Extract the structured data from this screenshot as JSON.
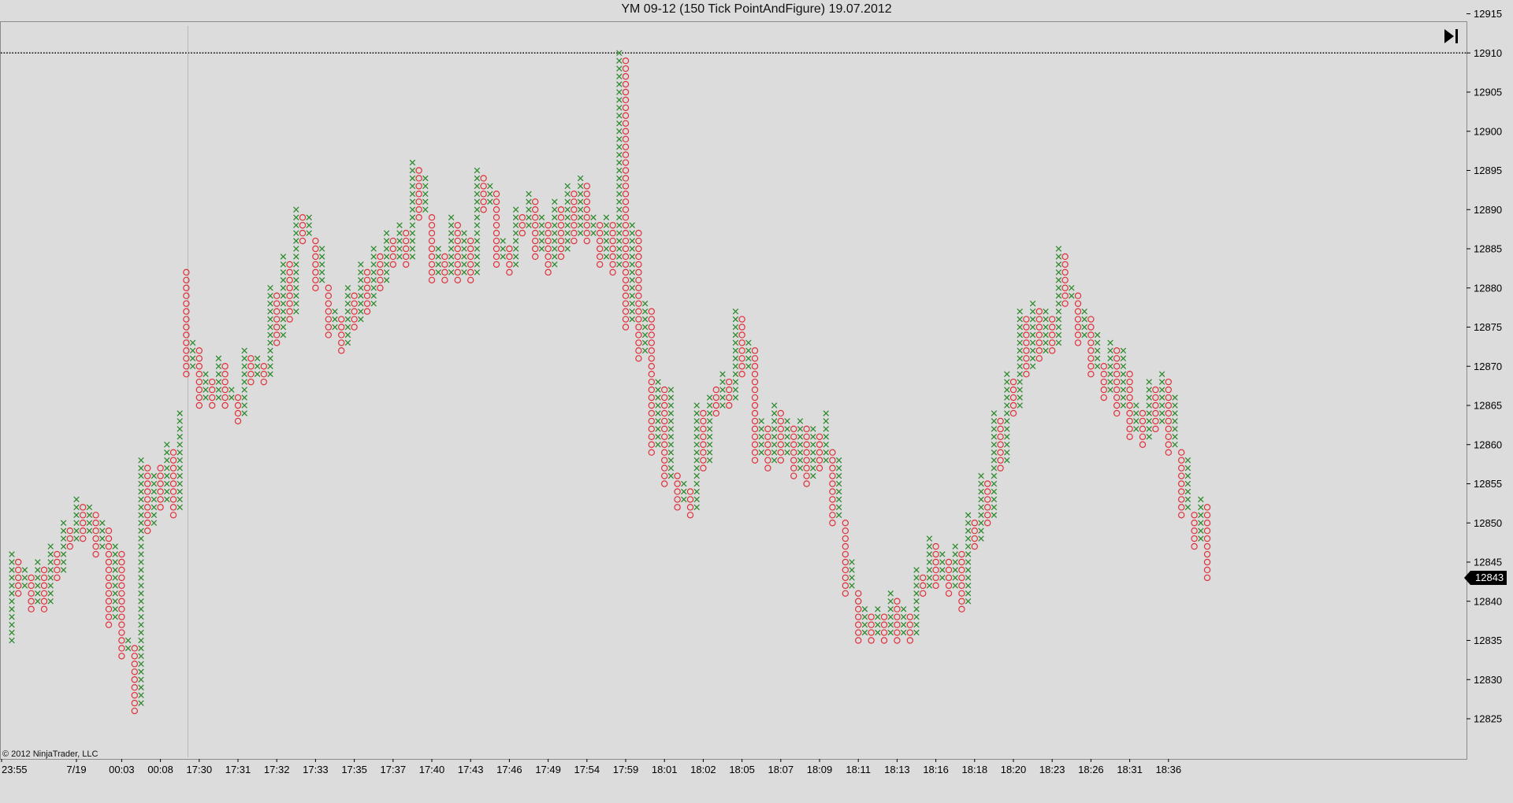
{
  "window": {
    "title": "YM 09-12 (150 Tick PointAndFigure)  19.07.2012"
  },
  "copyright": "© 2012 NinjaTrader, LLC",
  "last_price": "12843",
  "colors": {
    "up": "#2e8b2e",
    "down": "#e0303a",
    "background": "#dcdcdc",
    "grid": "#000000"
  },
  "icons": {
    "goto_end": "skip-to-end-icon"
  },
  "chart_data": {
    "type": "point-and-figure",
    "title": "YM 09-12 (150 Tick PointAndFigure)  19.07.2012",
    "box_size": 1,
    "y_range": [
      12823,
      12916
    ],
    "y_ticks": [
      12825,
      12830,
      12835,
      12840,
      12845,
      12850,
      12855,
      12860,
      12865,
      12870,
      12875,
      12880,
      12885,
      12890,
      12895,
      12900,
      12905,
      12910,
      12915
    ],
    "reference_line": 12910,
    "session_break_after_column": 27,
    "last_price": 12843,
    "x_tick_labels": [
      {
        "column": 0,
        "label": "23:55"
      },
      {
        "column": 10,
        "label": "7/19"
      },
      {
        "column": 17,
        "label": "00:03"
      },
      {
        "column": 23,
        "label": "00:08"
      },
      {
        "column": 29,
        "label": "17:30"
      },
      {
        "column": 35,
        "label": "17:31"
      },
      {
        "column": 41,
        "label": "17:32"
      },
      {
        "column": 47,
        "label": "17:33"
      },
      {
        "column": 53,
        "label": "17:35"
      },
      {
        "column": 59,
        "label": "17:37"
      },
      {
        "column": 65,
        "label": "17:40"
      },
      {
        "column": 71,
        "label": "17:43"
      },
      {
        "column": 77,
        "label": "17:46"
      },
      {
        "column": 83,
        "label": "17:49"
      },
      {
        "column": 89,
        "label": "17:54"
      },
      {
        "column": 95,
        "label": "17:59"
      },
      {
        "column": 101,
        "label": "18:01"
      },
      {
        "column": 107,
        "label": "18:02"
      },
      {
        "column": 113,
        "label": "18:05"
      },
      {
        "column": 119,
        "label": "18:07"
      },
      {
        "column": 125,
        "label": "18:09"
      },
      {
        "column": 131,
        "label": "18:11"
      },
      {
        "column": 137,
        "label": "18:13"
      },
      {
        "column": 143,
        "label": "18:16"
      },
      {
        "column": 149,
        "label": "18:18"
      },
      {
        "column": 155,
        "label": "18:20"
      },
      {
        "column": 161,
        "label": "18:23"
      },
      {
        "column": 167,
        "label": "18:26"
      },
      {
        "column": 173,
        "label": "18:31"
      },
      {
        "column": 179,
        "label": "18:36"
      }
    ],
    "columns": [
      {
        "t": "X",
        "lo": 12835,
        "hi": 12846
      },
      {
        "t": "O",
        "lo": 12841,
        "hi": 12845
      },
      {
        "t": "X",
        "lo": 12842,
        "hi": 12844
      },
      {
        "t": "O",
        "lo": 12839,
        "hi": 12843
      },
      {
        "t": "X",
        "lo": 12840,
        "hi": 12845
      },
      {
        "t": "O",
        "lo": 12839,
        "hi": 12844
      },
      {
        "t": "X",
        "lo": 12840,
        "hi": 12847
      },
      {
        "t": "O",
        "lo": 12843,
        "hi": 12846
      },
      {
        "t": "X",
        "lo": 12844,
        "hi": 12850
      },
      {
        "t": "O",
        "lo": 12847,
        "hi": 12849
      },
      {
        "t": "X",
        "lo": 12848,
        "hi": 12853
      },
      {
        "t": "O",
        "lo": 12848,
        "hi": 12852
      },
      {
        "t": "X",
        "lo": 12849,
        "hi": 12852
      },
      {
        "t": "O",
        "lo": 12846,
        "hi": 12851
      },
      {
        "t": "X",
        "lo": 12847,
        "hi": 12850
      },
      {
        "t": "O",
        "lo": 12837,
        "hi": 12849
      },
      {
        "t": "X",
        "lo": 12838,
        "hi": 12847
      },
      {
        "t": "O",
        "lo": 12833,
        "hi": 12846
      },
      {
        "t": "X",
        "lo": 12834,
        "hi": 12835
      },
      {
        "t": "O",
        "lo": 12826,
        "hi": 12834
      },
      {
        "t": "X",
        "lo": 12827,
        "hi": 12858
      },
      {
        "t": "O",
        "lo": 12849,
        "hi": 12857
      },
      {
        "t": "X",
        "lo": 12850,
        "hi": 12856
      },
      {
        "t": "O",
        "lo": 12852,
        "hi": 12857
      },
      {
        "t": "X",
        "lo": 12853,
        "hi": 12860
      },
      {
        "t": "O",
        "lo": 12851,
        "hi": 12859
      },
      {
        "t": "X",
        "lo": 12852,
        "hi": 12864
      },
      {
        "t": "O",
        "lo": 12869,
        "hi": 12882
      },
      {
        "t": "X",
        "lo": 12870,
        "hi": 12873
      },
      {
        "t": "O",
        "lo": 12865,
        "hi": 12872
      },
      {
        "t": "X",
        "lo": 12866,
        "hi": 12869
      },
      {
        "t": "O",
        "lo": 12865,
        "hi": 12868
      },
      {
        "t": "X",
        "lo": 12866,
        "hi": 12871
      },
      {
        "t": "O",
        "lo": 12865,
        "hi": 12870
      },
      {
        "t": "X",
        "lo": 12866,
        "hi": 12867
      },
      {
        "t": "O",
        "lo": 12863,
        "hi": 12866
      },
      {
        "t": "X",
        "lo": 12864,
        "hi": 12872
      },
      {
        "t": "O",
        "lo": 12868,
        "hi": 12871
      },
      {
        "t": "X",
        "lo": 12869,
        "hi": 12871
      },
      {
        "t": "O",
        "lo": 12868,
        "hi": 12870
      },
      {
        "t": "X",
        "lo": 12869,
        "hi": 12880
      },
      {
        "t": "O",
        "lo": 12873,
        "hi": 12879
      },
      {
        "t": "X",
        "lo": 12874,
        "hi": 12884
      },
      {
        "t": "O",
        "lo": 12876,
        "hi": 12883
      },
      {
        "t": "X",
        "lo": 12877,
        "hi": 12890
      },
      {
        "t": "O",
        "lo": 12886,
        "hi": 12889
      },
      {
        "t": "X",
        "lo": 12887,
        "hi": 12889
      },
      {
        "t": "O",
        "lo": 12880,
        "hi": 12886
      },
      {
        "t": "X",
        "lo": 12881,
        "hi": 12885
      },
      {
        "t": "O",
        "lo": 12874,
        "hi": 12880
      },
      {
        "t": "X",
        "lo": 12875,
        "hi": 12877
      },
      {
        "t": "O",
        "lo": 12872,
        "hi": 12876
      },
      {
        "t": "X",
        "lo": 12873,
        "hi": 12880
      },
      {
        "t": "O",
        "lo": 12875,
        "hi": 12879
      },
      {
        "t": "X",
        "lo": 12876,
        "hi": 12883
      },
      {
        "t": "O",
        "lo": 12877,
        "hi": 12882
      },
      {
        "t": "X",
        "lo": 12878,
        "hi": 12885
      },
      {
        "t": "O",
        "lo": 12880,
        "hi": 12884
      },
      {
        "t": "X",
        "lo": 12881,
        "hi": 12887
      },
      {
        "t": "O",
        "lo": 12883,
        "hi": 12886
      },
      {
        "t": "X",
        "lo": 12884,
        "hi": 12888
      },
      {
        "t": "O",
        "lo": 12883,
        "hi": 12887
      },
      {
        "t": "X",
        "lo": 12884,
        "hi": 12896
      },
      {
        "t": "O",
        "lo": 12889,
        "hi": 12895
      },
      {
        "t": "X",
        "lo": 12890,
        "hi": 12894
      },
      {
        "t": "O",
        "lo": 12881,
        "hi": 12889
      },
      {
        "t": "X",
        "lo": 12882,
        "hi": 12885
      },
      {
        "t": "O",
        "lo": 12881,
        "hi": 12884
      },
      {
        "t": "X",
        "lo": 12882,
        "hi": 12889
      },
      {
        "t": "O",
        "lo": 12881,
        "hi": 12888
      },
      {
        "t": "X",
        "lo": 12882,
        "hi": 12887
      },
      {
        "t": "O",
        "lo": 12881,
        "hi": 12886
      },
      {
        "t": "X",
        "lo": 12882,
        "hi": 12895
      },
      {
        "t": "O",
        "lo": 12890,
        "hi": 12894
      },
      {
        "t": "X",
        "lo": 12891,
        "hi": 12893
      },
      {
        "t": "O",
        "lo": 12883,
        "hi": 12892
      },
      {
        "t": "X",
        "lo": 12884,
        "hi": 12886
      },
      {
        "t": "O",
        "lo": 12882,
        "hi": 12885
      },
      {
        "t": "X",
        "lo": 12883,
        "hi": 12890
      },
      {
        "t": "O",
        "lo": 12887,
        "hi": 12889
      },
      {
        "t": "X",
        "lo": 12888,
        "hi": 12892
      },
      {
        "t": "O",
        "lo": 12884,
        "hi": 12891
      },
      {
        "t": "X",
        "lo": 12885,
        "hi": 12889
      },
      {
        "t": "O",
        "lo": 12882,
        "hi": 12888
      },
      {
        "t": "X",
        "lo": 12883,
        "hi": 12891
      },
      {
        "t": "O",
        "lo": 12884,
        "hi": 12890
      },
      {
        "t": "X",
        "lo": 12885,
        "hi": 12893
      },
      {
        "t": "O",
        "lo": 12886,
        "hi": 12892
      },
      {
        "t": "X",
        "lo": 12887,
        "hi": 12894
      },
      {
        "t": "O",
        "lo": 12886,
        "hi": 12893
      },
      {
        "t": "X",
        "lo": 12887,
        "hi": 12889
      },
      {
        "t": "O",
        "lo": 12883,
        "hi": 12888
      },
      {
        "t": "X",
        "lo": 12884,
        "hi": 12889
      },
      {
        "t": "O",
        "lo": 12882,
        "hi": 12888
      },
      {
        "t": "X",
        "lo": 12883,
        "hi": 12910
      },
      {
        "t": "O",
        "lo": 12875,
        "hi": 12909
      },
      {
        "t": "X",
        "lo": 12876,
        "hi": 12888
      },
      {
        "t": "O",
        "lo": 12871,
        "hi": 12887
      },
      {
        "t": "X",
        "lo": 12872,
        "hi": 12878
      },
      {
        "t": "O",
        "lo": 12859,
        "hi": 12877
      },
      {
        "t": "X",
        "lo": 12860,
        "hi": 12868
      },
      {
        "t": "O",
        "lo": 12855,
        "hi": 12867
      },
      {
        "t": "X",
        "lo": 12856,
        "hi": 12867
      },
      {
        "t": "O",
        "lo": 12852,
        "hi": 12856
      },
      {
        "t": "X",
        "lo": 12853,
        "hi": 12855
      },
      {
        "t": "O",
        "lo": 12851,
        "hi": 12854
      },
      {
        "t": "X",
        "lo": 12852,
        "hi": 12865
      },
      {
        "t": "O",
        "lo": 12857,
        "hi": 12864
      },
      {
        "t": "X",
        "lo": 12858,
        "hi": 12866
      },
      {
        "t": "O",
        "lo": 12864,
        "hi": 12867
      },
      {
        "t": "X",
        "lo": 12865,
        "hi": 12869
      },
      {
        "t": "O",
        "lo": 12865,
        "hi": 12868
      },
      {
        "t": "X",
        "lo": 12866,
        "hi": 12877
      },
      {
        "t": "O",
        "lo": 12869,
        "hi": 12876
      },
      {
        "t": "X",
        "lo": 12870,
        "hi": 12873
      },
      {
        "t": "O",
        "lo": 12858,
        "hi": 12872
      },
      {
        "t": "X",
        "lo": 12859,
        "hi": 12863
      },
      {
        "t": "O",
        "lo": 12857,
        "hi": 12862
      },
      {
        "t": "X",
        "lo": 12858,
        "hi": 12865
      },
      {
        "t": "O",
        "lo": 12858,
        "hi": 12864
      },
      {
        "t": "X",
        "lo": 12859,
        "hi": 12863
      },
      {
        "t": "O",
        "lo": 12856,
        "hi": 12862
      },
      {
        "t": "X",
        "lo": 12857,
        "hi": 12863
      },
      {
        "t": "O",
        "lo": 12855,
        "hi": 12862
      },
      {
        "t": "X",
        "lo": 12856,
        "hi": 12862
      },
      {
        "t": "O",
        "lo": 12857,
        "hi": 12861
      },
      {
        "t": "X",
        "lo": 12858,
        "hi": 12864
      },
      {
        "t": "O",
        "lo": 12850,
        "hi": 12859
      },
      {
        "t": "X",
        "lo": 12851,
        "hi": 12858
      },
      {
        "t": "O",
        "lo": 12841,
        "hi": 12850
      },
      {
        "t": "X",
        "lo": 12842,
        "hi": 12845
      },
      {
        "t": "O",
        "lo": 12835,
        "hi": 12841
      },
      {
        "t": "X",
        "lo": 12836,
        "hi": 12839
      },
      {
        "t": "O",
        "lo": 12835,
        "hi": 12838
      },
      {
        "t": "X",
        "lo": 12836,
        "hi": 12839
      },
      {
        "t": "O",
        "lo": 12835,
        "hi": 12838
      },
      {
        "t": "X",
        "lo": 12836,
        "hi": 12841
      },
      {
        "t": "O",
        "lo": 12835,
        "hi": 12840
      },
      {
        "t": "X",
        "lo": 12836,
        "hi": 12839
      },
      {
        "t": "O",
        "lo": 12835,
        "hi": 12838
      },
      {
        "t": "X",
        "lo": 12836,
        "hi": 12844
      },
      {
        "t": "O",
        "lo": 12841,
        "hi": 12843
      },
      {
        "t": "X",
        "lo": 12842,
        "hi": 12848
      },
      {
        "t": "O",
        "lo": 12842,
        "hi": 12847
      },
      {
        "t": "X",
        "lo": 12843,
        "hi": 12846
      },
      {
        "t": "O",
        "lo": 12841,
        "hi": 12845
      },
      {
        "t": "X",
        "lo": 12842,
        "hi": 12847
      },
      {
        "t": "O",
        "lo": 12839,
        "hi": 12846
      },
      {
        "t": "X",
        "lo": 12840,
        "hi": 12851
      },
      {
        "t": "O",
        "lo": 12847,
        "hi": 12850
      },
      {
        "t": "X",
        "lo": 12848,
        "hi": 12856
      },
      {
        "t": "O",
        "lo": 12850,
        "hi": 12855
      },
      {
        "t": "X",
        "lo": 12851,
        "hi": 12864
      },
      {
        "t": "O",
        "lo": 12857,
        "hi": 12863
      },
      {
        "t": "X",
        "lo": 12858,
        "hi": 12869
      },
      {
        "t": "O",
        "lo": 12864,
        "hi": 12868
      },
      {
        "t": "X",
        "lo": 12865,
        "hi": 12877
      },
      {
        "t": "O",
        "lo": 12869,
        "hi": 12876
      },
      {
        "t": "X",
        "lo": 12870,
        "hi": 12878
      },
      {
        "t": "O",
        "lo": 12871,
        "hi": 12877
      },
      {
        "t": "X",
        "lo": 12872,
        "hi": 12877
      },
      {
        "t": "O",
        "lo": 12872,
        "hi": 12876
      },
      {
        "t": "X",
        "lo": 12873,
        "hi": 12885
      },
      {
        "t": "O",
        "lo": 12878,
        "hi": 12884
      },
      {
        "t": "X",
        "lo": 12879,
        "hi": 12880
      },
      {
        "t": "O",
        "lo": 12873,
        "hi": 12879
      },
      {
        "t": "X",
        "lo": 12874,
        "hi": 12877
      },
      {
        "t": "O",
        "lo": 12869,
        "hi": 12876
      },
      {
        "t": "X",
        "lo": 12870,
        "hi": 12874
      },
      {
        "t": "O",
        "lo": 12866,
        "hi": 12870
      },
      {
        "t": "X",
        "lo": 12867,
        "hi": 12873
      },
      {
        "t": "O",
        "lo": 12864,
        "hi": 12872
      },
      {
        "t": "X",
        "lo": 12865,
        "hi": 12872
      },
      {
        "t": "O",
        "lo": 12861,
        "hi": 12869
      },
      {
        "t": "X",
        "lo": 12862,
        "hi": 12865
      },
      {
        "t": "O",
        "lo": 12860,
        "hi": 12864
      },
      {
        "t": "X",
        "lo": 12861,
        "hi": 12868
      },
      {
        "t": "O",
        "lo": 12862,
        "hi": 12867
      },
      {
        "t": "X",
        "lo": 12863,
        "hi": 12869
      },
      {
        "t": "O",
        "lo": 12859,
        "hi": 12868
      },
      {
        "t": "X",
        "lo": 12860,
        "hi": 12866
      },
      {
        "t": "O",
        "lo": 12851,
        "hi": 12859
      },
      {
        "t": "X",
        "lo": 12852,
        "hi": 12858
      },
      {
        "t": "O",
        "lo": 12847,
        "hi": 12851
      },
      {
        "t": "X",
        "lo": 12848,
        "hi": 12853
      },
      {
        "t": "O",
        "lo": 12843,
        "hi": 12852
      }
    ]
  }
}
